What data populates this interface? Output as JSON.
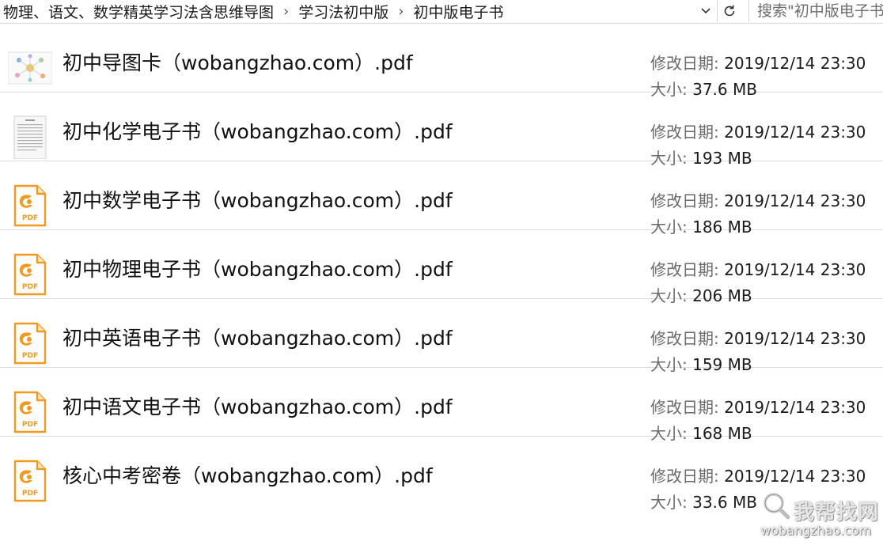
{
  "address_bar": {
    "breadcrumb": [
      "物理、语文、数学精英学习法含思维导图",
      "学习法初中版",
      "初中版电子书"
    ],
    "search_placeholder": "搜索\"初中版电子书\""
  },
  "meta_labels": {
    "modified": "修改日期:",
    "size": "大小:"
  },
  "files": [
    {
      "name": "初中导图卡（wobangzhao.com）.pdf",
      "modified": "2019/12/14 23:30",
      "size": "37.6 MB",
      "icon": "mindmap-thumbnail-icon"
    },
    {
      "name": "初中化学电子书（wobangzhao.com）.pdf",
      "modified": "2019/12/14 23:30",
      "size": "193 MB",
      "icon": "document-thumbnail-icon"
    },
    {
      "name": "初中数学电子书（wobangzhao.com）.pdf",
      "modified": "2019/12/14 23:30",
      "size": "186 MB",
      "icon": "pdf-file-icon"
    },
    {
      "name": "初中物理电子书（wobangzhao.com）.pdf",
      "modified": "2019/12/14 23:30",
      "size": "206 MB",
      "icon": "pdf-file-icon"
    },
    {
      "name": "初中英语电子书（wobangzhao.com）.pdf",
      "modified": "2019/12/14 23:30",
      "size": "159 MB",
      "icon": "pdf-file-icon"
    },
    {
      "name": "初中语文电子书（wobangzhao.com）.pdf",
      "modified": "2019/12/14 23:30",
      "size": "168 MB",
      "icon": "pdf-file-icon"
    },
    {
      "name": "核心中考密卷（wobangzhao.com）.pdf",
      "modified": "2019/12/14 23:30",
      "size": "33.6 MB",
      "icon": "pdf-file-icon"
    }
  ],
  "pdf_icon_label": "PDF",
  "watermark": {
    "text": "我帮找网",
    "domain": "wobangzhao.com"
  },
  "colors": {
    "pdf_orange": "#f39a1e",
    "separator": "#dcdcdc",
    "label_gray": "#6a6a6a"
  }
}
